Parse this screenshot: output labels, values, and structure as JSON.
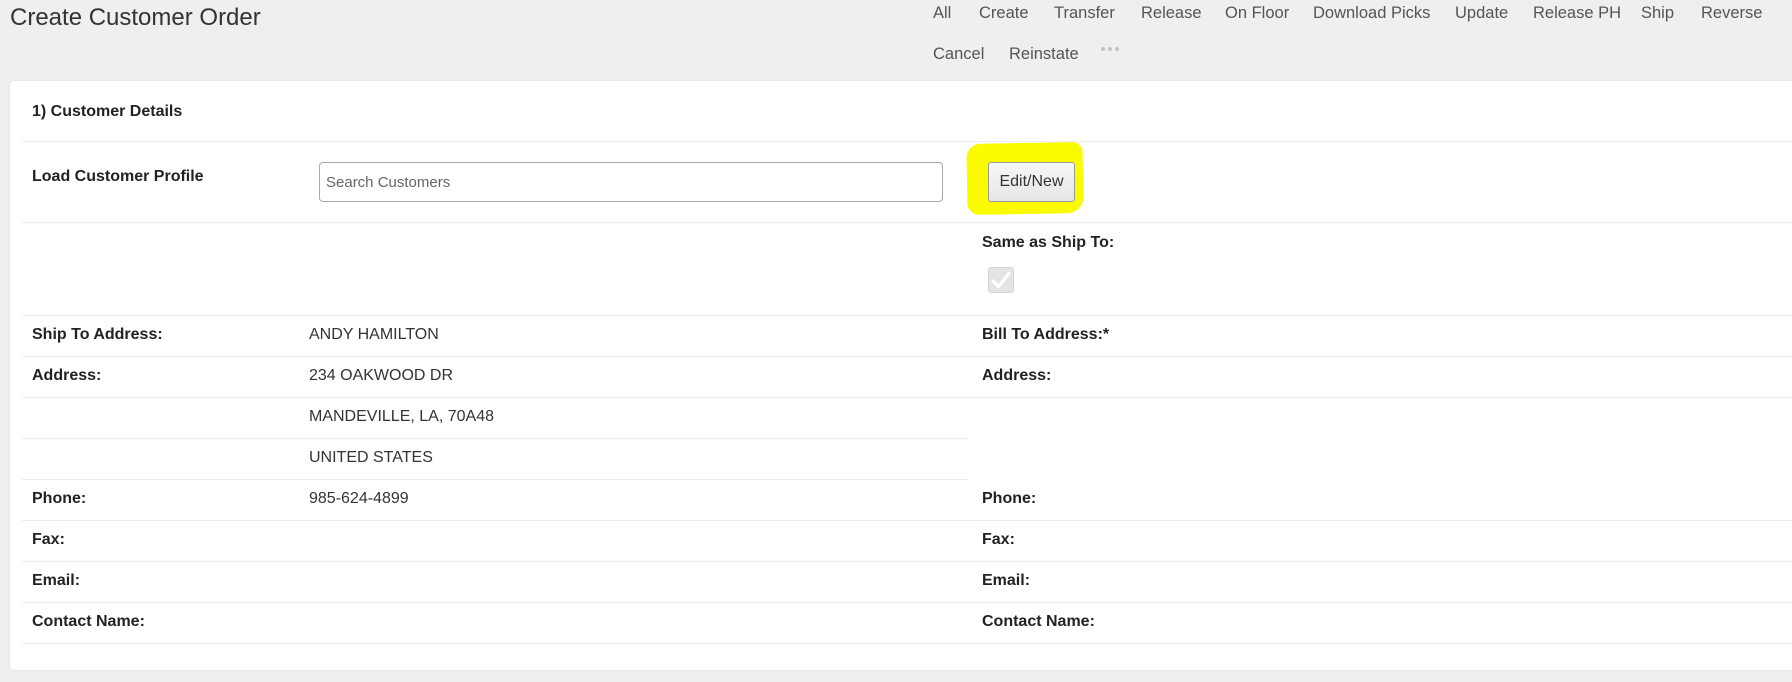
{
  "header": {
    "title": "Create Customer Order"
  },
  "nav": {
    "row1": [
      "All",
      "Create",
      "Transfer",
      "Release",
      "On Floor",
      "Download Picks",
      "Update",
      "Release PH",
      "Ship",
      "Reverse"
    ],
    "row2": [
      "Cancel",
      "Reinstate"
    ],
    "more_icon": "ellipsis-icon"
  },
  "section": {
    "title": "1) Customer Details"
  },
  "profile": {
    "label": "Load Customer Profile",
    "search_placeholder": "Search Customers",
    "search_value": "",
    "edit_button": "Edit/New",
    "highlight_color": "#fafa00"
  },
  "same_as": {
    "label": "Same as Ship To:",
    "checked": true,
    "check_icon": "check-icon"
  },
  "ship_to": {
    "label": "Ship To Address:",
    "name": "ANDY HAMILTON",
    "address_label": "Address:",
    "address_line1": "234 OAKWOOD DR",
    "address_line2": "MANDEVILLE, LA, 70A48",
    "address_line3": "UNITED STATES",
    "phone_label": "Phone:",
    "phone": "985-624-4899",
    "fax_label": "Fax:",
    "email_label": "Email:",
    "contact_label": "Contact Name:"
  },
  "bill_to": {
    "label": "Bill To Address:*",
    "address_label": "Address:",
    "phone_label": "Phone:",
    "fax_label": "Fax:",
    "email_label": "Email:",
    "contact_label": "Contact Name:"
  }
}
